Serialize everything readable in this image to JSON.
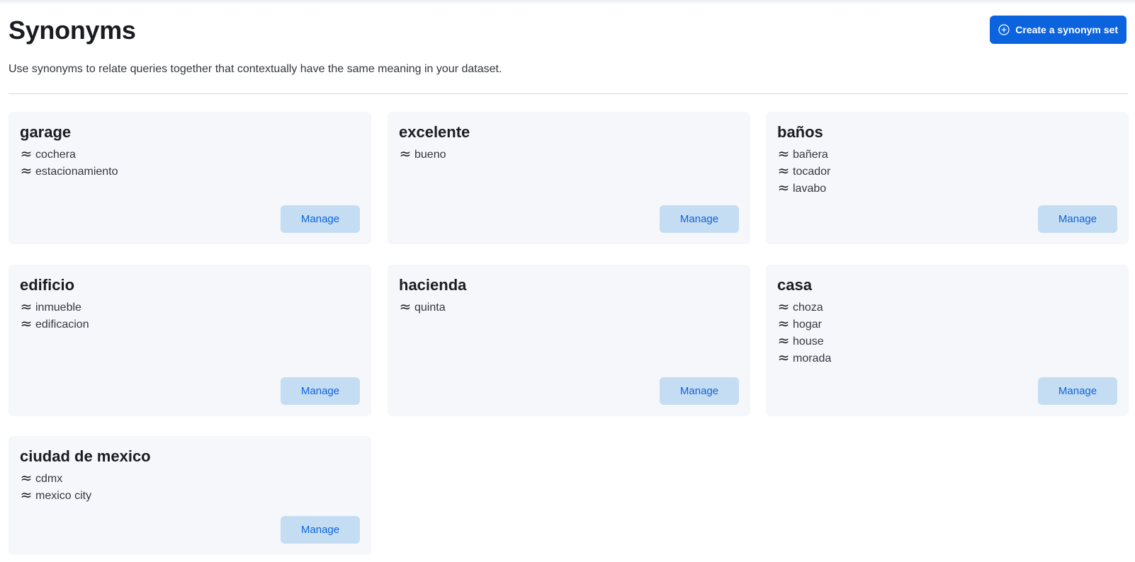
{
  "header": {
    "title": "Synonyms",
    "subtitle": "Use synonyms to relate queries together that contextually have the same meaning in your dataset.",
    "create_label": "Create a synonym set"
  },
  "manage_label": "Manage",
  "cards": [
    {
      "title": "garage",
      "synonyms": [
        "cochera",
        "estacionamiento"
      ]
    },
    {
      "title": "excelente",
      "synonyms": [
        "bueno"
      ]
    },
    {
      "title": "baños",
      "synonyms": [
        "bañera",
        "tocador",
        "lavabo"
      ]
    },
    {
      "title": "edificio",
      "synonyms": [
        "inmueble",
        "edificacion"
      ]
    },
    {
      "title": "hacienda",
      "synonyms": [
        "quinta"
      ]
    },
    {
      "title": "casa",
      "synonyms": [
        "choza",
        "hogar",
        "house",
        "morada"
      ]
    },
    {
      "title": "ciudad de mexico",
      "synonyms": [
        "cdmx",
        "mexico city"
      ]
    }
  ]
}
